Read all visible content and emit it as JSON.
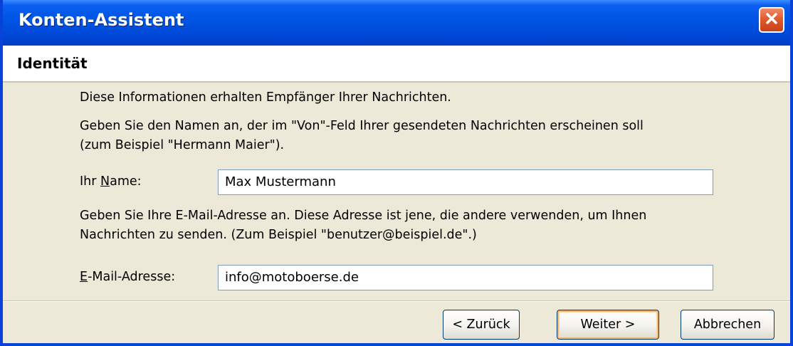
{
  "window": {
    "title": "Konten-Assistent",
    "close_icon": "close-icon"
  },
  "header": {
    "title": "Identität"
  },
  "main": {
    "intro": "Diese Informationen erhalten Empfänger Ihrer Nachrichten.",
    "name_instruction": "Geben Sie den Namen an, der im \"Von\"-Feld Ihrer gesendeten Nachrichten erscheinen soll\n(zum Beispiel \"Hermann Maier\").",
    "name_label_prefix": "Ihr ",
    "name_label_mnemonic": "N",
    "name_label_suffix": "ame:",
    "name_value": "Max Mustermann",
    "email_instruction": "Geben Sie Ihre E-Mail-Adresse an. Diese Adresse ist jene, die andere verwenden, um Ihnen\nNachrichten zu senden. (Zum Beispiel \"benutzer@beispiel.de\".)",
    "email_label_mnemonic": "E",
    "email_label_suffix": "-Mail-Adresse:",
    "email_value": "info@motoboerse.de"
  },
  "buttons": {
    "back": "< Zurück",
    "next": "Weiter >",
    "cancel": "Abbrechen"
  },
  "colors": {
    "titlebar": "#0054e3",
    "close": "#e25a2f",
    "dialog_bg": "#ece9d8",
    "default_button_ring": "#f3b66e"
  }
}
